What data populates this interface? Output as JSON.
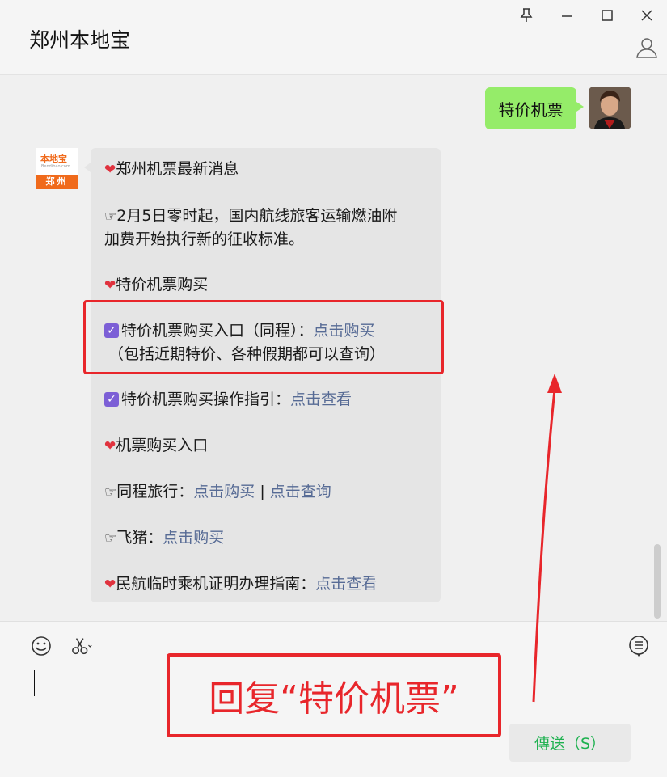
{
  "window": {
    "title": "郑州本地宝",
    "controls": [
      "pin-icon",
      "minimize-icon",
      "maximize-icon",
      "close-icon"
    ]
  },
  "chat": {
    "outgoing_message": "特价机票",
    "sender_avatar": {
      "logo_text": "本地宝",
      "logo_small": "Bendibao.com",
      "city": "郑州"
    },
    "incoming": {
      "l1": "郑州机票最新消息",
      "l2": "2月5日零时起，国内航线旅客运输燃油附",
      "l3": "加费开始执行新的征收标准。",
      "l4": "特价机票购买",
      "l5_text": "特价机票购买入口（同程）：",
      "l5_link": "点击购买",
      "l6": "（包括近期特价、各种假期都可以查询）",
      "l7_text": "特价机票购买操作指引：",
      "l7_link": "点击查看",
      "l8": "机票购买入口",
      "l9_text": "同程旅行：",
      "l9_link1": "点击购买",
      "l9_sep": " | ",
      "l9_link2": "点击查询",
      "l10_text": "飞猪：",
      "l10_link": "点击购买",
      "l11_text": "民航临时乘机证明办理指南：",
      "l11_link": "点击查看"
    }
  },
  "composer": {
    "send_label": "傳送（S）"
  },
  "annotation": {
    "text": "回复“特价机票”",
    "color": "#e8262b"
  },
  "colors": {
    "outgoing_bubble": "#95ec69",
    "link": "#576b95",
    "send_text": "#1db14f"
  }
}
